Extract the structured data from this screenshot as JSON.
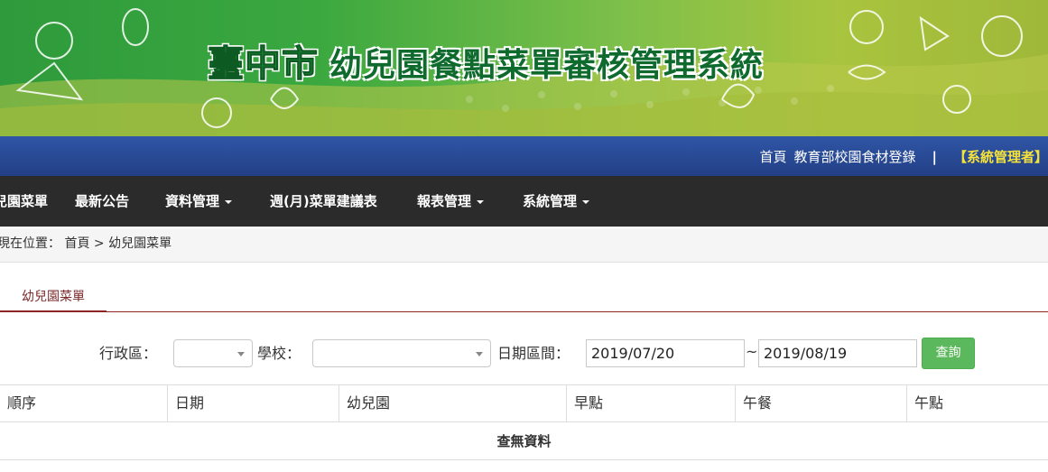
{
  "banner": {
    "city": "臺中市",
    "title": "幼兒園餐點菜單審核管理系統"
  },
  "toplinks": {
    "home": "首頁",
    "moe": "教育部校園食材登錄",
    "separator": "|",
    "admin": "【系統管理者】"
  },
  "nav": {
    "items": [
      {
        "label": "幼兒園菜單",
        "dropdown": false
      },
      {
        "label": "最新公告",
        "dropdown": false
      },
      {
        "label": "資料管理",
        "dropdown": true
      },
      {
        "label": "週(月)菜單建議表",
        "dropdown": false
      },
      {
        "label": "報表管理",
        "dropdown": true
      },
      {
        "label": "系統管理",
        "dropdown": true
      }
    ]
  },
  "breadcrumb": {
    "text": "現在位置： 首頁 > 幼兒園菜單"
  },
  "tab": {
    "label": "幼兒園菜單"
  },
  "filters": {
    "district_label": "行政區：",
    "district_value": "",
    "school_label": "學校：",
    "school_value": "",
    "date_label": "日期區間：",
    "date_start": "2019/07/20",
    "tilde": "~",
    "date_end": "2019/08/19",
    "search_button": "查詢"
  },
  "table": {
    "headers": [
      "順序",
      "日期",
      "幼兒園",
      "早點",
      "午餐",
      "午點"
    ],
    "empty_message": "查無資料"
  },
  "colors": {
    "banner_green": "#3aa83f",
    "topbar_blue": "#2f56a6",
    "navbar_dark": "#2b2b2b",
    "admin_yellow": "#f6e33a",
    "tab_red": "#8c2424",
    "button_green": "#5cb85c"
  }
}
